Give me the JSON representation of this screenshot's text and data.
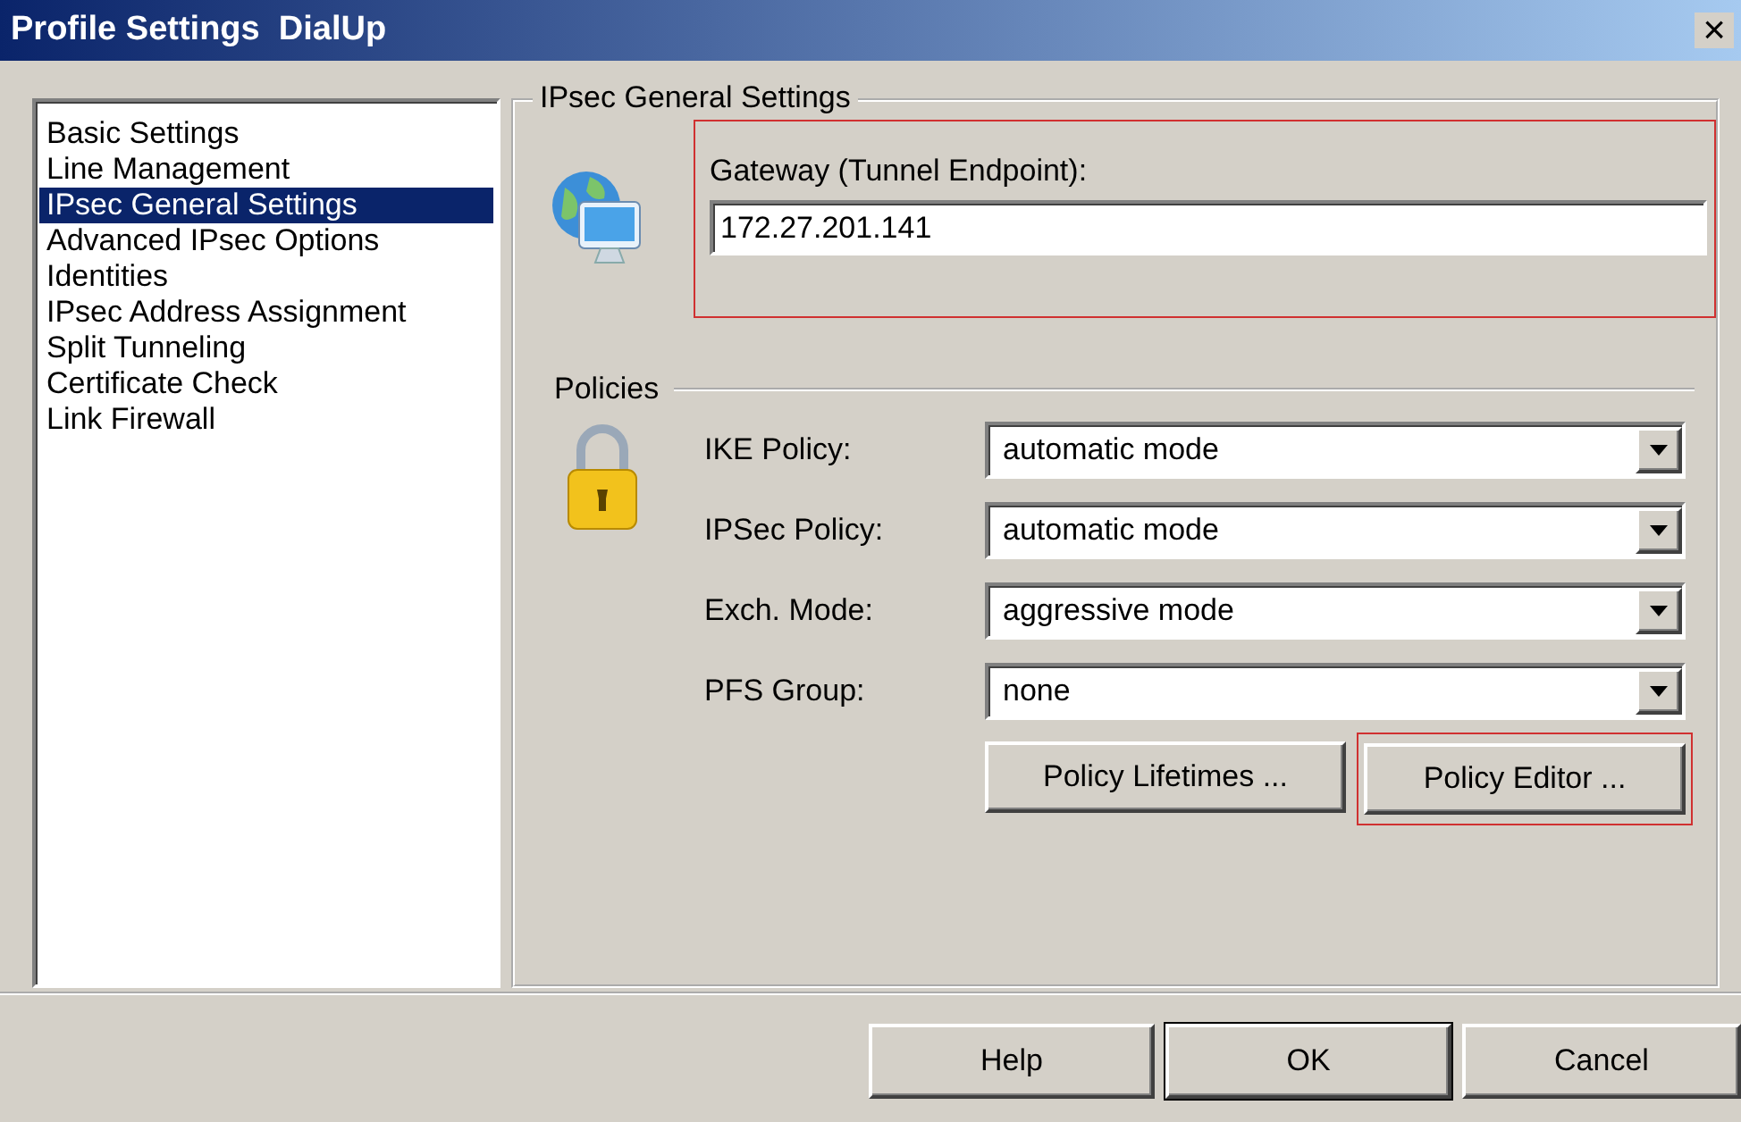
{
  "window": {
    "title": "Profile Settings  DialUp",
    "close": "×"
  },
  "sidebar": {
    "items": [
      {
        "label": "Basic Settings",
        "selected": false
      },
      {
        "label": "Line Management",
        "selected": false
      },
      {
        "label": "IPsec General Settings",
        "selected": true
      },
      {
        "label": "Advanced IPsec Options",
        "selected": false
      },
      {
        "label": "Identities",
        "selected": false
      },
      {
        "label": "IPsec Address Assignment",
        "selected": false
      },
      {
        "label": "Split Tunneling",
        "selected": false
      },
      {
        "label": "Certificate Check",
        "selected": false
      },
      {
        "label": "Link Firewall",
        "selected": false
      }
    ]
  },
  "group": {
    "title": "IPsec General Settings",
    "gateway": {
      "label": "Gateway (Tunnel Endpoint):",
      "value": "172.27.201.141",
      "highlighted": true
    },
    "policies": {
      "title": "Policies",
      "rows": [
        {
          "label": "IKE Policy:",
          "value": "automatic mode"
        },
        {
          "label": "IPSec Policy:",
          "value": "automatic mode"
        },
        {
          "label": "Exch. Mode:",
          "value": "aggressive mode"
        },
        {
          "label": "PFS Group:",
          "value": "none"
        }
      ],
      "buttons": [
        {
          "label": "Policy Lifetimes ...",
          "highlighted": false
        },
        {
          "label": "Policy Editor ...",
          "highlighted": true
        }
      ]
    }
  },
  "buttons": [
    {
      "label": "Help",
      "default": false
    },
    {
      "label": "OK",
      "default": true
    },
    {
      "label": "Cancel",
      "default": false
    }
  ]
}
